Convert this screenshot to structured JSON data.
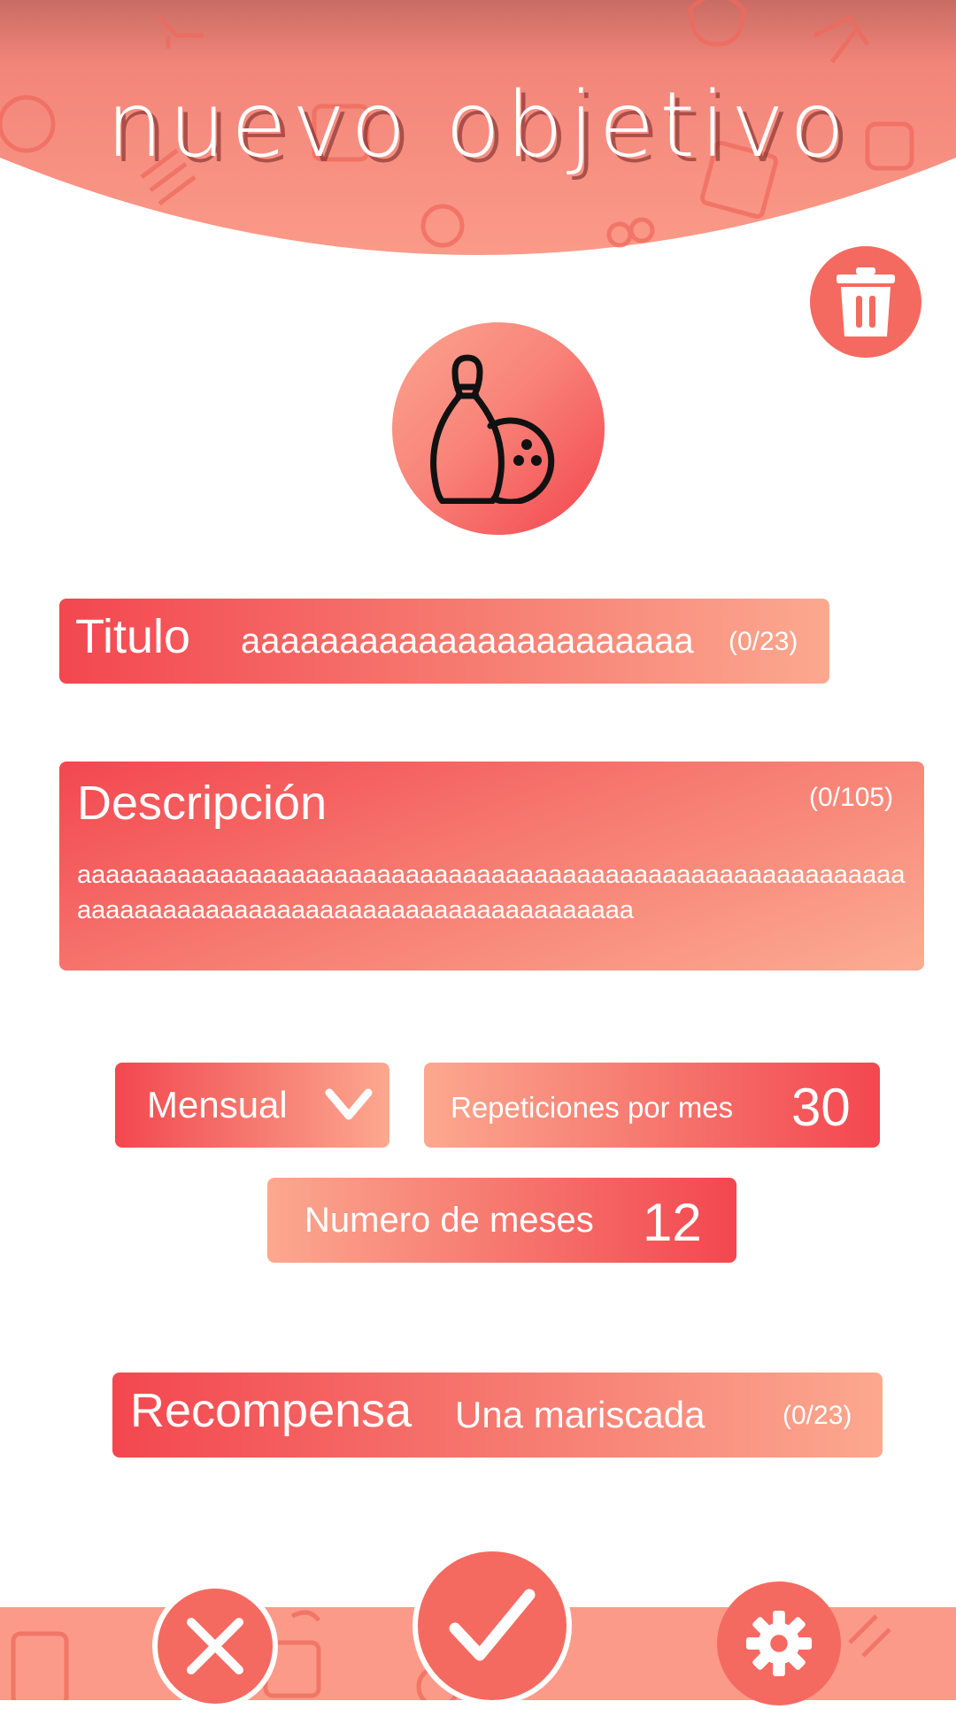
{
  "header": {
    "title": "nuevo objetivo"
  },
  "colors": {
    "accent": "#f46a60",
    "gradient_dark": "#f3474f",
    "gradient_light": "#fca88f"
  },
  "icons": {
    "delete": "trash-icon",
    "category": "bowling-icon",
    "dropdown": "chevron-down-icon",
    "cancel": "close-icon",
    "confirm": "check-icon",
    "settings": "gear-icon"
  },
  "form": {
    "titulo": {
      "label": "Titulo",
      "value": "aaaaaaaaaaaaaaaaaaaaaaa",
      "counter": "(0/23)"
    },
    "descripcion": {
      "label": "Descripción",
      "counter": "(0/105)",
      "value": "aaaaaaaaaaaaaaaaaaaaaaaaaaaaaaaaaaaaaaaaaaaaaaaaaaaaaaaaaaaaaaaaaaaaaaaaaaaaaaaaaaaaaaaaaaaaaaaaa"
    },
    "frecuencia": {
      "value": "Mensual"
    },
    "repeticiones": {
      "label": "Repeticiones por mes",
      "value": "30"
    },
    "meses": {
      "label": "Numero de meses",
      "value": "12"
    },
    "recompensa": {
      "label": "Recompensa",
      "value": "Una mariscada",
      "counter": "(0/23)"
    }
  }
}
